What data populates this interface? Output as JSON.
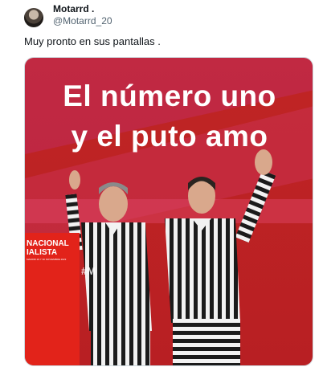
{
  "tweet": {
    "display_name": "Motarrd .",
    "handle": "@Motarrd_20",
    "text": "Muy pronto en sus pantallas ."
  },
  "image": {
    "headline_line1": "El número uno",
    "headline_line2": "y el puto amo",
    "lectern_line1": "NACIONAL",
    "lectern_line2": "IALISTA",
    "lectern_small": "MADRID 29 Y 30 NOVIEMBRE 2023",
    "hashtag": "#M"
  },
  "colors": {
    "background_red": "#c8241f",
    "lectern_red": "#e2231a",
    "stripe_dark": "#1b1b1b",
    "stripe_light": "#f2f2f2"
  }
}
